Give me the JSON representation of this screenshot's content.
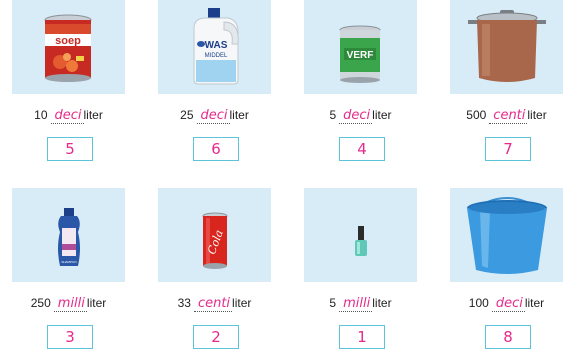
{
  "items": [
    {
      "icon": "soup-can-icon",
      "amount": "10",
      "prefix": "deci",
      "unit": "liter",
      "answer": "5",
      "label_text": "soep"
    },
    {
      "icon": "detergent-bottle-icon",
      "amount": "25",
      "prefix": "deci",
      "unit": "liter",
      "answer": "6",
      "label_text": "WAS MIDDEL"
    },
    {
      "icon": "paint-can-icon",
      "amount": "5",
      "prefix": "deci",
      "unit": "liter",
      "answer": "4",
      "label_text": "VERF"
    },
    {
      "icon": "cooking-pot-icon",
      "amount": "500",
      "prefix": "centi",
      "unit": "liter",
      "answer": "7"
    },
    {
      "icon": "shampoo-bottle-icon",
      "amount": "250",
      "prefix": "milli",
      "unit": "liter",
      "answer": "3",
      "label_text": "SHAMPOO"
    },
    {
      "icon": "cola-can-icon",
      "amount": "33",
      "prefix": "centi",
      "unit": "liter",
      "answer": "2",
      "label_text": "Cola"
    },
    {
      "icon": "nail-polish-icon",
      "amount": "5",
      "prefix": "milli",
      "unit": "liter",
      "answer": "1"
    },
    {
      "icon": "bucket-icon",
      "amount": "100",
      "prefix": "deci",
      "unit": "liter",
      "answer": "8"
    }
  ],
  "colors": {
    "panel": "#d8ecf7",
    "handwriting": "#e62a8c",
    "box_border": "#5cc3d9"
  }
}
